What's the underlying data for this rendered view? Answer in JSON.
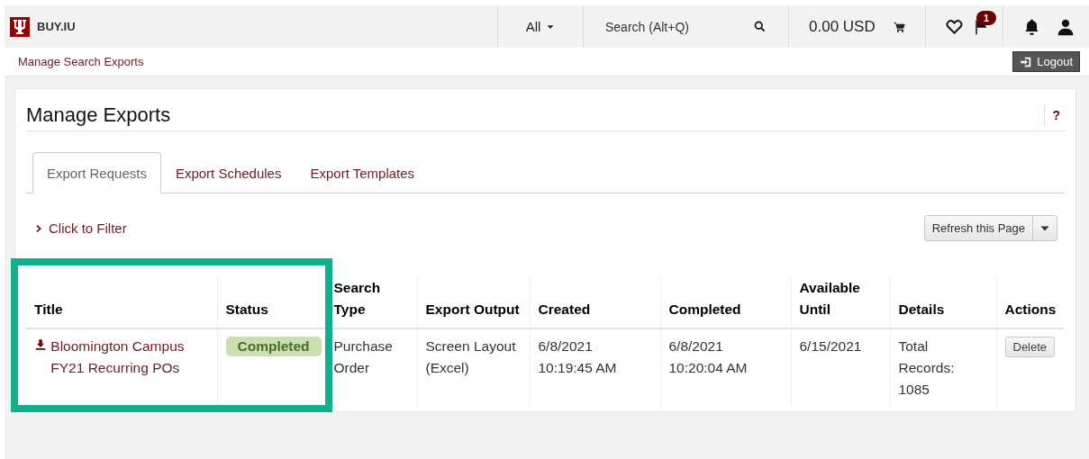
{
  "header": {
    "brand": "BUY.IU",
    "scope": "All",
    "search": {
      "placeholder": "Search (Alt+Q)"
    },
    "cart_total": "0.00 USD",
    "flag_count": "1"
  },
  "breadcrumb": "Manage Search Exports",
  "logout": "Logout",
  "page": {
    "title": "Manage Exports",
    "help": "?"
  },
  "tabs": [
    {
      "label": "Export Requests",
      "selected": true
    },
    {
      "label": "Export Schedules",
      "selected": false
    },
    {
      "label": "Export Templates",
      "selected": false
    }
  ],
  "filter": "Click to Filter",
  "refresh": "Refresh this Page",
  "table": {
    "columns": [
      "Title",
      "Status",
      "Search Type",
      "Export Output",
      "Created",
      "Completed",
      "Available Until",
      "Details",
      "Actions"
    ],
    "rows": [
      {
        "title": "Bloomington Campus FY21 Recurring POs",
        "status": "Completed",
        "search_type": "Purchase Order",
        "export_output": "Screen Layout (Excel)",
        "created": "6/8/2021\n10:19:45 AM",
        "completed": "6/8/2021\n10:20:04 AM",
        "available_until": "6/15/2021",
        "details": "Total Records: 1085",
        "action": "Delete"
      }
    ]
  },
  "highlight_frame": true
}
